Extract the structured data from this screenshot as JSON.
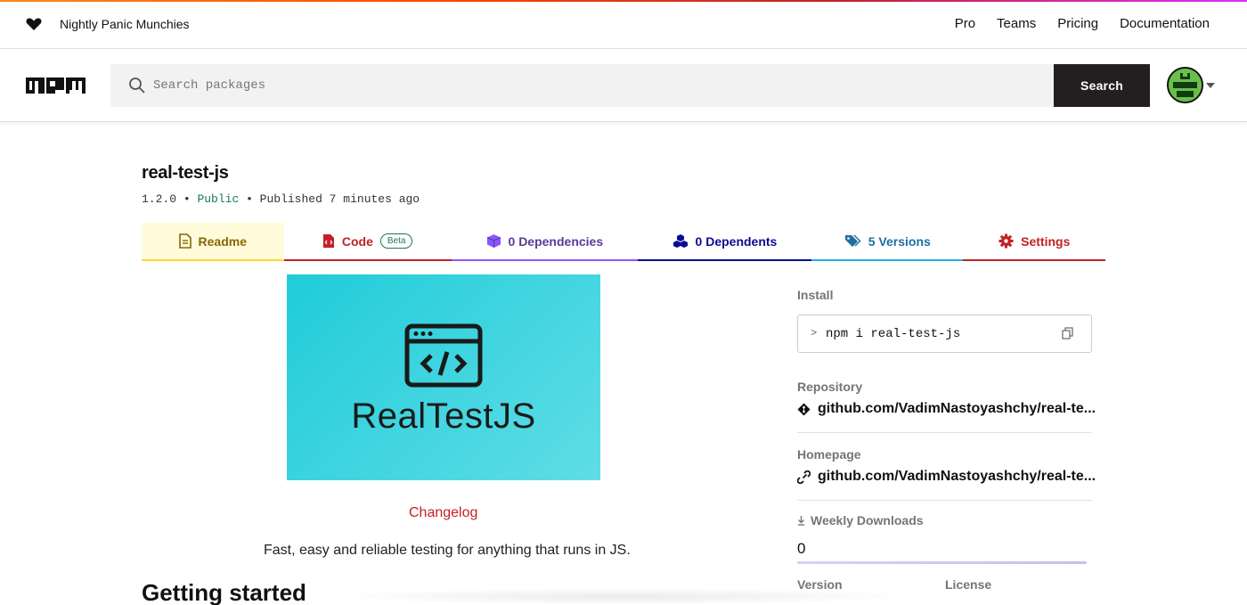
{
  "topbar": {
    "tagline": "Nightly Panic Munchies",
    "nav": [
      "Pro",
      "Teams",
      "Pricing",
      "Documentation"
    ]
  },
  "search": {
    "placeholder": "Search packages",
    "button": "Search"
  },
  "package": {
    "name": "real-test-js",
    "version": "1.2.0",
    "visibility": "Public",
    "published": "Published 7 minutes ago"
  },
  "tabs": {
    "readme": "Readme",
    "code": "Code",
    "beta": "Beta",
    "dependencies": "0 Dependencies",
    "dependents": "0 Dependents",
    "versions": "5 Versions",
    "settings": "Settings"
  },
  "readme": {
    "hero_text": "RealTestJS",
    "changelog": "Changelog",
    "description": "Fast, easy and reliable testing for anything that runs in JS.",
    "heading": "Getting started"
  },
  "sidebar": {
    "install_label": "Install",
    "install_cmd": "npm i real-test-js",
    "repository_label": "Repository",
    "repository": "github.com/VadimNastoyashchy/real-te...",
    "homepage_label": "Homepage",
    "homepage": "github.com/VadimNastoyashchy/real-te...",
    "downloads_label": "Weekly Downloads",
    "downloads": "0",
    "version_label": "Version",
    "license_label": "License"
  },
  "colors": {
    "brand_red": "#c12127",
    "search_button": "#231f20",
    "public_green": "#1c7a50",
    "hero_teal": "#20ccd9"
  },
  "icons": [
    "heart-icon",
    "npm-logo",
    "search-icon",
    "avatar",
    "readme-icon",
    "code-icon",
    "dependencies-icon",
    "dependents-icon",
    "versions-icon",
    "settings-icon",
    "code-window-icon",
    "copy-icon",
    "git-icon",
    "link-icon",
    "download-icon"
  ]
}
